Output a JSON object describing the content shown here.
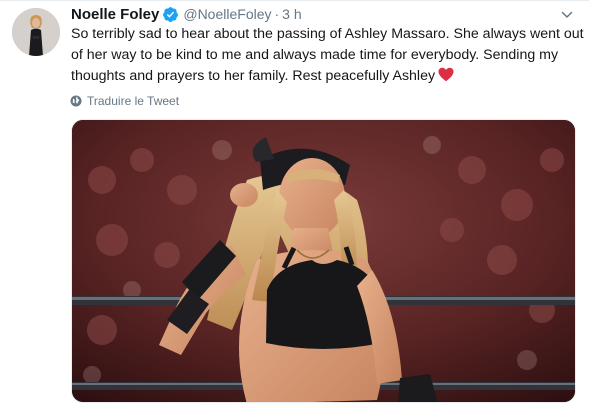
{
  "tweet": {
    "author_name": "Noelle Foley",
    "handle": "@NoelleFoley",
    "separator": "·",
    "time": "3 h",
    "lines": [
      "So terribly sad to hear about the passing of Ashley Massaro. She always went out",
      "of her way to be kind to me and always made time for everybody. Sending my",
      "thoughts and prayers to her family. Rest peacefully Ashley"
    ],
    "translate_label": "Traduire le Tweet"
  },
  "icons": {
    "verified": "verified-badge-icon",
    "caret": "chevron-down-icon",
    "heart": "red-heart-emoji",
    "globe": "globe-icon"
  },
  "colors": {
    "verified_blue": "#1da1f2",
    "heart_red": "#dd2e44",
    "secondary_text": "#657786"
  }
}
